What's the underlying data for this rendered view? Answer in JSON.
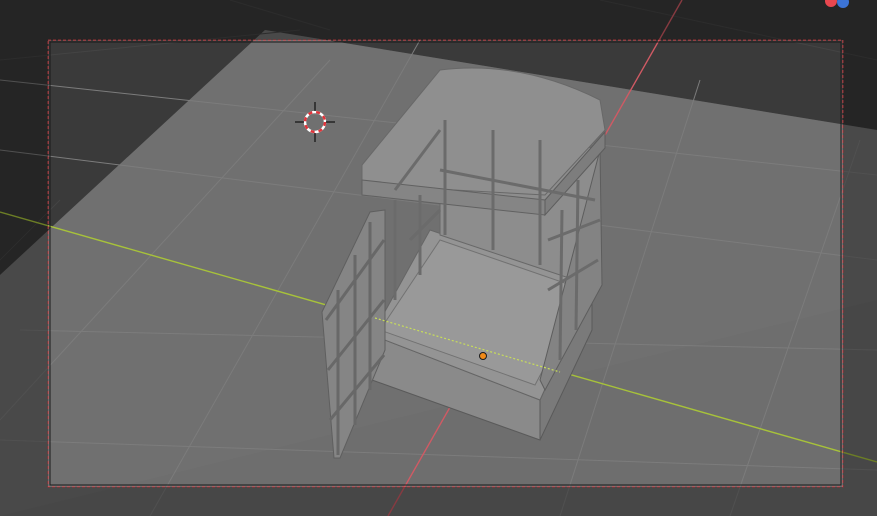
{
  "viewport": {
    "background_color": "#393939",
    "floor_color": "#6b6b6b",
    "x_axis_color": "#b4d236",
    "y_axis_color": "#d6545f",
    "camera_frame_color": "#e8474f",
    "origin_color": "#f08a18"
  },
  "gizmo": {
    "x_axis_color": "#e8474f",
    "z_axis_color": "#3c74d6"
  },
  "icons": {
    "cursor": "3d-cursor-icon",
    "origin": "object-origin-icon",
    "gizmo": "navigation-gizmo-icon"
  }
}
